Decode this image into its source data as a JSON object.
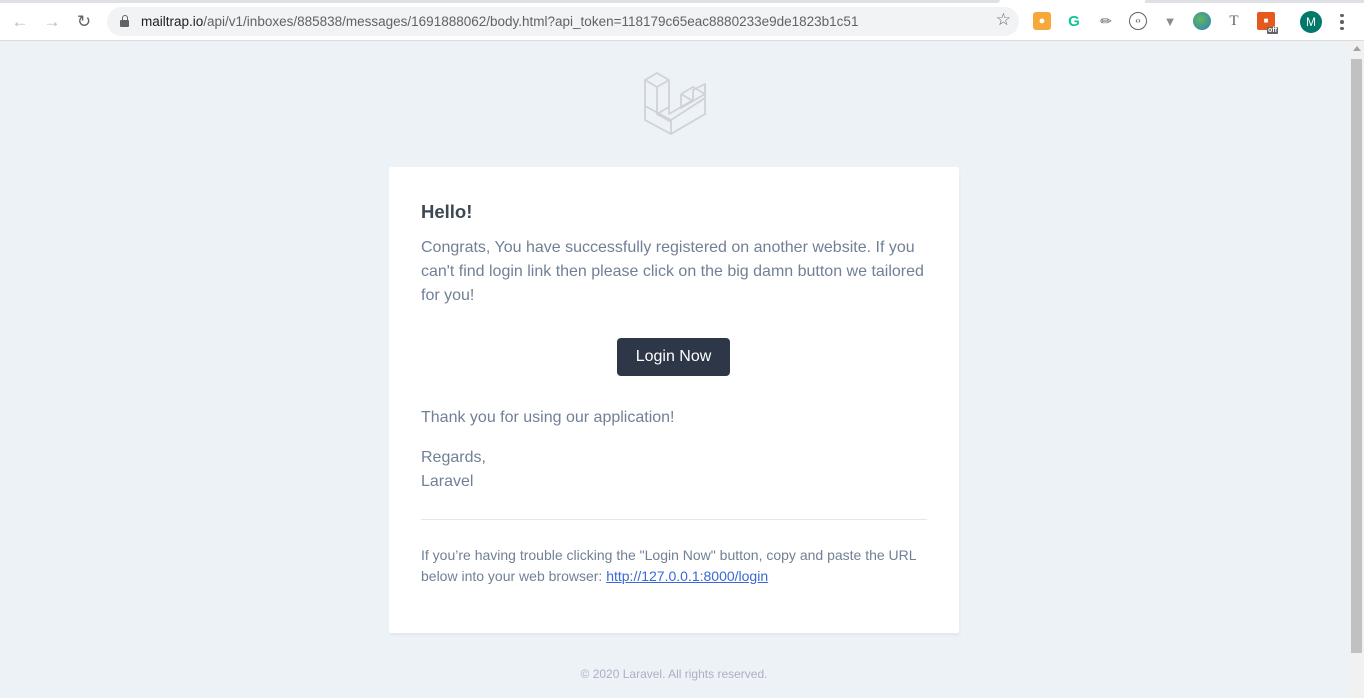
{
  "browser": {
    "url_host": "mailtrap.io",
    "url_path": "/api/v1/inboxes/885838/messages/1691888062/body.html?api_token=118179c65eac8880233e9de1823b1c51",
    "avatar_letter": "M",
    "extensions": [
      "extension-1-icon",
      "grammarly-icon",
      "extension-3-icon",
      "extension-4-icon",
      "vuejs-devtools-icon",
      "extension-6-icon",
      "extension-7-icon",
      "extension-8-icon"
    ],
    "extension_badge_off": "off"
  },
  "email": {
    "greeting": "Hello!",
    "intro": "Congrats, You have successfully registered on another website. If you can't find login link then please click on the big damn button we tailored for you!",
    "action_label": "Login Now",
    "thanks": "Thank you for using our application!",
    "regards_line": "Regards,",
    "sender": "Laravel",
    "subcopy_text": "If you’re having trouble clicking the \"Login Now\" button, copy and paste the URL below into your web browser:",
    "subcopy_link": "http://127.0.0.1:8000/login",
    "footer": "© 2020 Laravel. All rights reserved."
  },
  "colors": {
    "page_bg": "#edf2f7",
    "button_bg": "#2d3748",
    "body_text": "#718096",
    "heading_text": "#3d4852",
    "link": "#3869d4"
  }
}
